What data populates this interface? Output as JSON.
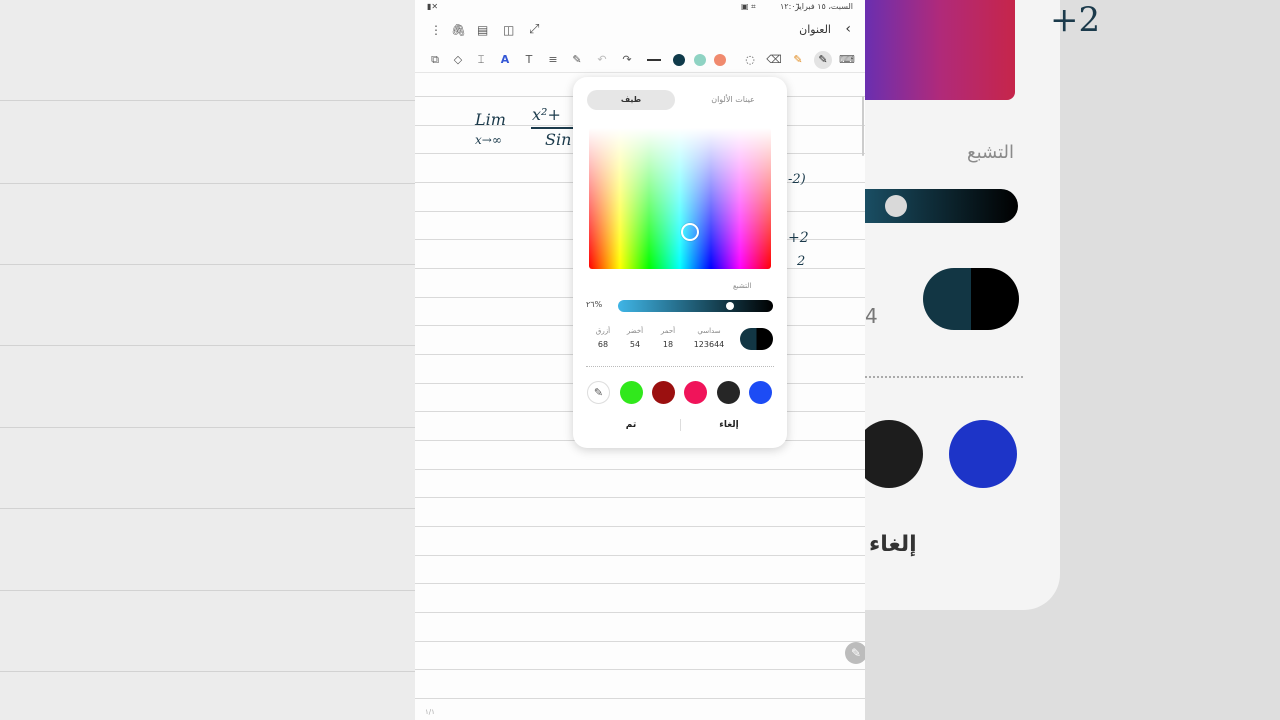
{
  "statusbar": {
    "datetime": "السبت، ١٥ فبراير",
    "time": "١٢:٠٦"
  },
  "titlebar": {
    "title": "العنوان",
    "back_icon": "chevron-right-icon"
  },
  "toolbar": {
    "pen_colors": [
      "#0f3a4a",
      "#8fd3c3",
      "#f08a6e"
    ],
    "icons": [
      "keyboard-icon",
      "pen-icon",
      "highlighter-icon",
      "eraser-icon",
      "lasso-icon",
      "line-style-icon",
      "redo-icon",
      "undo-icon",
      "pen-settings-icon",
      "text-align-icon",
      "text-icon",
      "text-style-icon",
      "text-box-icon",
      "shapes-icon",
      "attachment-image-icon"
    ]
  },
  "notes": {
    "lim": "Lim",
    "sub": "x→∞",
    "numerator": "x²+",
    "denominator": "Sin",
    "right_frag1": "-2)",
    "right_frag2": "+2",
    "right_frag3": "2",
    "page_number": "١/١"
  },
  "dialog": {
    "tab_spectrum": "طيف",
    "tab_swatches": "عينات الألوان",
    "saturation_label": "التشبع",
    "saturation_value": "٢٦%",
    "saturation_level": 0.74,
    "hex_label": "سداسي",
    "hex_value": "123644",
    "red_label": "أحمر",
    "red_value": "18",
    "green_label": "أخضر",
    "green_value": "54",
    "blue_label": "أزرق",
    "blue_value": "68",
    "selected_color": "#123644",
    "swatches": [
      "#1d4cf5",
      "#262626",
      "#f0145a",
      "#9b1010",
      "#31e81c"
    ],
    "cancel": "إلغاء",
    "done": "تم"
  },
  "backdrop_right": {
    "saturation_label": "التشبع",
    "num": "4",
    "cancel": "إلغاء",
    "math": "+2"
  }
}
